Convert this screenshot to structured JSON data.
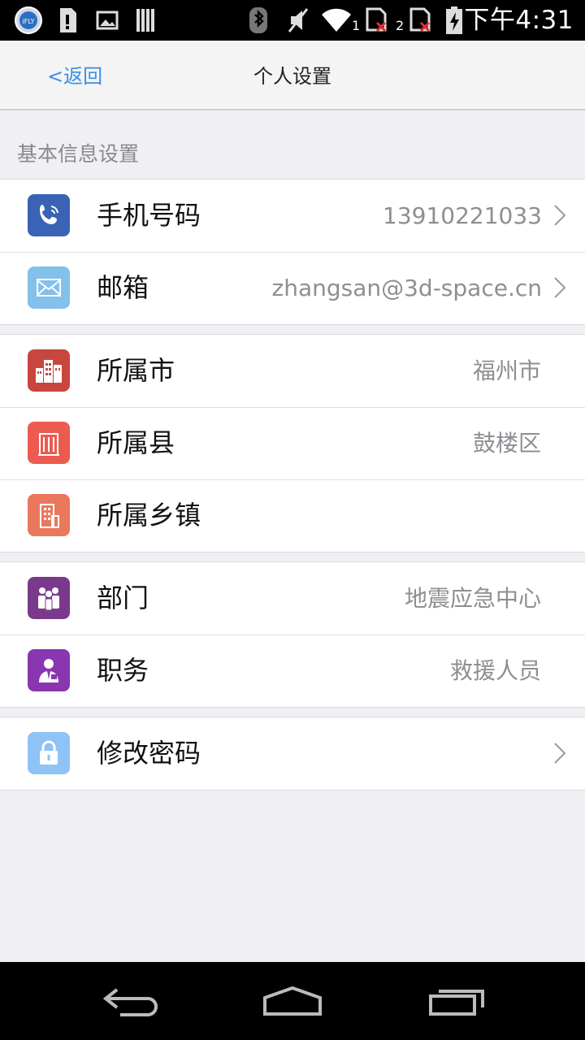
{
  "status_bar": {
    "time": "下午4:31",
    "sim1": "1",
    "sim2": "2",
    "icons": [
      "ifly-app-icon",
      "sd-card-icon",
      "image-icon",
      "barcode-icon",
      "bluetooth-icon",
      "mute-icon",
      "wifi-icon",
      "sim-missing-icon",
      "sim-missing-icon",
      "battery-charging-icon"
    ]
  },
  "nav": {
    "back_label": "<返回",
    "title": "个人设置"
  },
  "section_header": "基本信息设置",
  "groups": [
    {
      "rows": [
        {
          "label": "手机号码",
          "value": "13910221033",
          "icon": "phone-icon",
          "icon_color": "#3a63b5",
          "chevron": true
        },
        {
          "label": "邮箱",
          "value": "zhangsan@3d-space.cn",
          "icon": "mail-icon",
          "icon_color": "#83c0ea",
          "chevron": true
        }
      ]
    },
    {
      "rows": [
        {
          "label": "所属市",
          "value": "福州市",
          "icon": "city-buildings-icon",
          "icon_color": "#c9463e",
          "chevron": false
        },
        {
          "label": "所属县",
          "value": "鼓楼区",
          "icon": "county-building-icon",
          "icon_color": "#ec5b4f",
          "chevron": false
        },
        {
          "label": "所属乡镇",
          "value": "",
          "icon": "town-building-icon",
          "icon_color": "#ea785c",
          "chevron": false
        }
      ]
    },
    {
      "rows": [
        {
          "label": "部门",
          "value": "地震应急中心",
          "icon": "department-people-icon",
          "icon_color": "#7a3a8c",
          "chevron": false
        },
        {
          "label": "职务",
          "value": "救援人员",
          "icon": "position-person-icon",
          "icon_color": "#8a36b0",
          "chevron": false
        }
      ]
    },
    {
      "rows": [
        {
          "label": "修改密码",
          "value": "",
          "icon": "lock-icon",
          "icon_color": "#8fc2f5",
          "chevron": true
        }
      ]
    }
  ],
  "system_nav": [
    "back-icon",
    "home-icon",
    "recent-apps-icon"
  ]
}
